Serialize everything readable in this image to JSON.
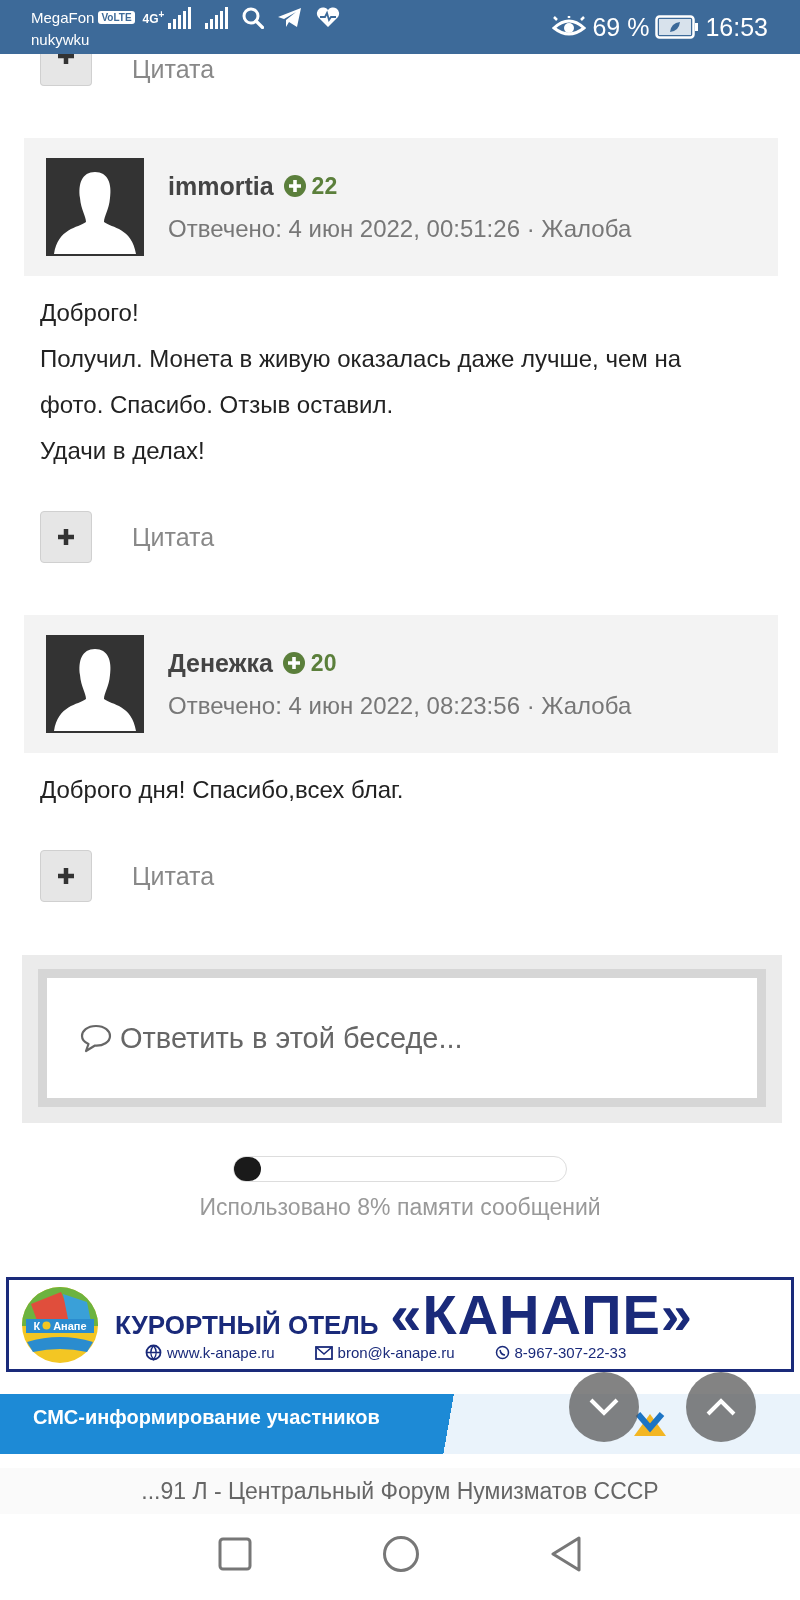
{
  "status_bar": {
    "carrier": "MegaFon",
    "volte": "VoLTE",
    "network": "4G$^{+}$",
    "operator": "nukywku",
    "battery_percent": "69 %",
    "time": "16:53"
  },
  "top_quote": {
    "label": "Цитата"
  },
  "posts": [
    {
      "author": "immortia",
      "reputation": "22",
      "meta": "Отвечено: 4 июн 2022, 00:51:26 · Жалоба",
      "body": [
        "Доброго!",
        "Получил. Монета в живую оказалась даже лучше, чем на фото. Спасибо. Отзыв оставил.",
        "Удачи в делах!"
      ],
      "quote": "Цитата"
    },
    {
      "author": "Денежка",
      "reputation": "20",
      "meta": "Отвечено: 4 июн 2022, 08:23:56 · Жалоба",
      "body": [
        "Доброго дня! Спасибо,всех благ."
      ],
      "quote": "Цитата"
    }
  ],
  "reply": {
    "placeholder": "Ответить в этой беседе..."
  },
  "storage": {
    "level": 0.08,
    "caption": "Использовано 8% памяти сообщений"
  },
  "hotel_ad": {
    "logo_left": "К",
    "logo_right": "Анапе",
    "title": "КУРОРТНЫЙ ОТЕЛЬ",
    "name": "«КАНАПЕ»",
    "website": "www.k-anape.ru",
    "email": "bron@k-anape.ru",
    "phone": "8-967-307-22-33"
  },
  "sms_ad": {
    "text": "СМС-информирование участников"
  },
  "page_title": "...91 Л - Центральный Форум Нумизматов СССР"
}
